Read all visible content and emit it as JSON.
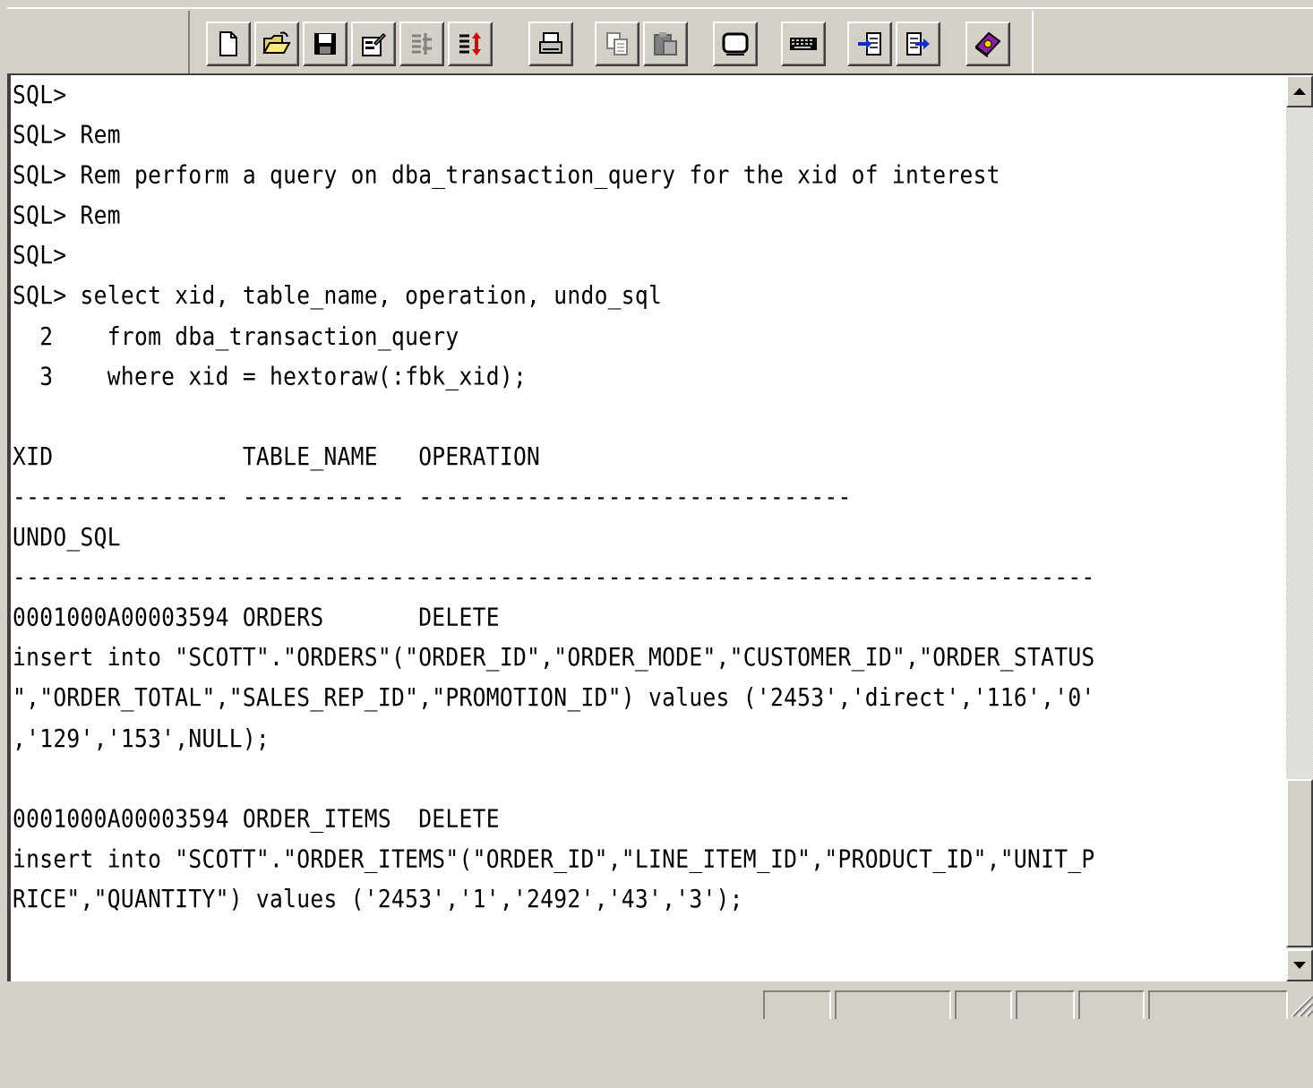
{
  "toolbar": {
    "groups": [
      [
        "new-file-icon",
        "open-folder-icon",
        "save-icon",
        "properties-icon",
        "column-format-icon",
        "sort-icon"
      ],
      [
        "print-icon"
      ],
      [
        "copy-icon",
        "paste-icon"
      ],
      [
        "screen-icon"
      ],
      [
        "keyboard-icon"
      ],
      [
        "import-icon",
        "export-icon"
      ],
      [
        "help-book-icon"
      ]
    ]
  },
  "console": {
    "lines": [
      "SQL>",
      "SQL> Rem",
      "SQL> Rem perform a query on dba_transaction_query for the xid of interest",
      "SQL> Rem",
      "SQL>",
      "SQL> select xid, table_name, operation, undo_sql",
      "  2    from dba_transaction_query",
      "  3    where xid = hextoraw(:fbk_xid);",
      "",
      "XID              TABLE_NAME   OPERATION",
      "---------------- ------------ --------------------------------",
      "UNDO_SQL",
      "--------------------------------------------------------------------------------",
      "0001000A00003594 ORDERS       DELETE",
      "insert into \"SCOTT\".\"ORDERS\"(\"ORDER_ID\",\"ORDER_MODE\",\"CUSTOMER_ID\",\"ORDER_STATUS",
      "\",\"ORDER_TOTAL\",\"SALES_REP_ID\",\"PROMOTION_ID\") values ('2453','direct','116','0'",
      ",'129','153',NULL);",
      "",
      "0001000A00003594 ORDER_ITEMS  DELETE",
      "insert into \"SCOTT\".\"ORDER_ITEMS\"(\"ORDER_ID\",\"LINE_ITEM_ID\",\"PRODUCT_ID\",\"UNIT_P",
      "RICE\",\"QUANTITY\") values ('2453','1','2492','43','3');"
    ]
  },
  "statusbar": {
    "panels": [
      "",
      "",
      "",
      "",
      "",
      ""
    ]
  }
}
